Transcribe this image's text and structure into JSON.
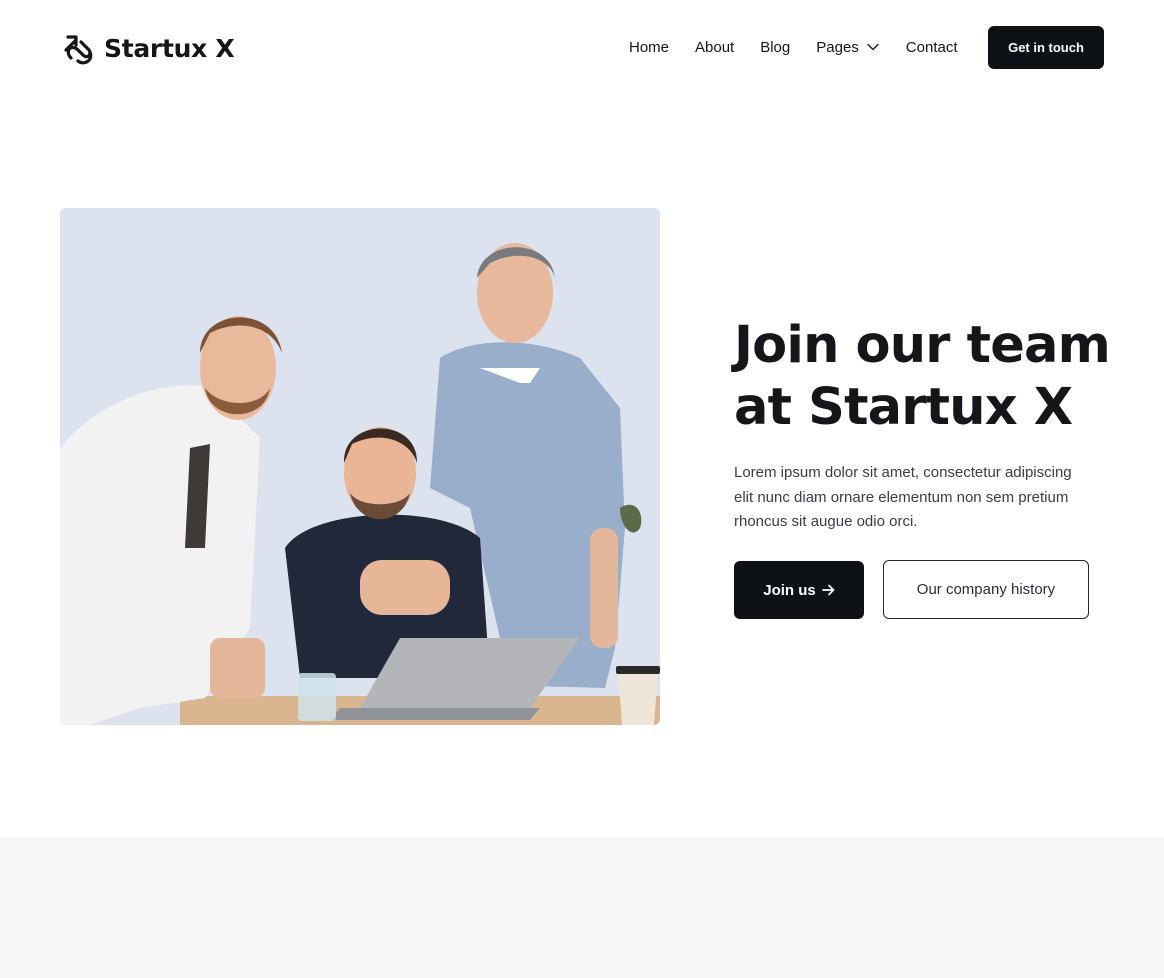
{
  "brand": {
    "name": "Startux X",
    "logo_icon": "link-arrow-icon"
  },
  "nav": {
    "items": [
      {
        "label": "Home"
      },
      {
        "label": "About"
      },
      {
        "label": "Blog"
      },
      {
        "label": "Pages",
        "icon": "chevron-down-icon"
      },
      {
        "label": "Contact"
      }
    ],
    "cta_label": "Get in touch"
  },
  "hero": {
    "title": "Join our team at Startux X",
    "description": "Lorem ipsum dolor sit amet, consectetur adipiscing elit nunc diam ornare elementum non sem pretium rhoncus sit augue odio orci.",
    "primary_button": {
      "label": "Join us",
      "icon": "arrow-right-icon"
    },
    "secondary_button": {
      "label": "Our company history"
    },
    "image": {
      "subject": "team-photo"
    }
  },
  "colors": {
    "dark": "#0e1116",
    "text": "#14161a",
    "muted_text": "#3a3d44",
    "image_bg": "#dde3ee",
    "band_bg": "#f6f6f7"
  }
}
